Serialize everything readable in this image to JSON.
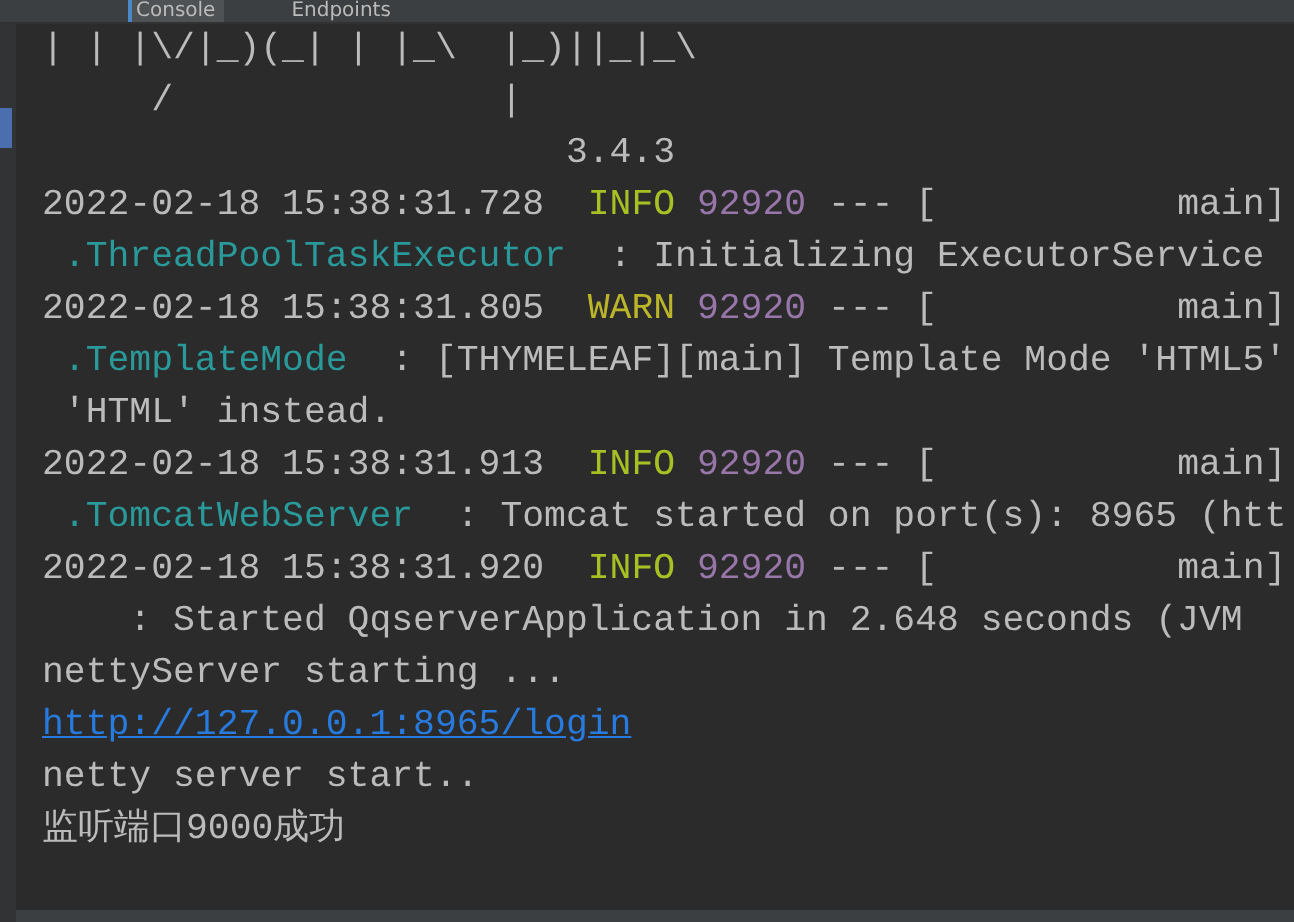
{
  "tabs": [
    {
      "label": "Console",
      "selected": true
    },
    {
      "label": "Endpoints",
      "selected": false
    }
  ],
  "lines": [
    {
      "segments": [
        {
          "kind": "plain",
          "text": "| | |\\/|_)(_| | |_\\  |_)||_|_\\"
        }
      ]
    },
    {
      "segments": [
        {
          "kind": "plain",
          "text": "     /               |"
        }
      ]
    },
    {
      "segments": [
        {
          "kind": "plain",
          "text": "                        3.4.3"
        }
      ]
    },
    {
      "segments": [
        {
          "kind": "plain",
          "text": "2022-02-18 15:38:31.728  "
        },
        {
          "kind": "info",
          "text": "INFO"
        },
        {
          "kind": "pid",
          "text": " 92920"
        },
        {
          "kind": "plain",
          "text": " --- [           main]"
        }
      ]
    },
    {
      "segments": [
        {
          "kind": "logger",
          "text": " .ThreadPoolTaskExecutor"
        },
        {
          "kind": "plain",
          "text": "  : Initializing ExecutorService"
        }
      ]
    },
    {
      "segments": [
        {
          "kind": "plain",
          "text": "2022-02-18 15:38:31.805  "
        },
        {
          "kind": "warn",
          "text": "WARN"
        },
        {
          "kind": "pid",
          "text": " 92920"
        },
        {
          "kind": "plain",
          "text": " --- [           main]"
        }
      ]
    },
    {
      "segments": [
        {
          "kind": "logger",
          "text": " .TemplateMode"
        },
        {
          "kind": "plain",
          "text": "  : [THYMELEAF][main] Template Mode 'HTML5'"
        }
      ]
    },
    {
      "segments": [
        {
          "kind": "plain",
          "text": " 'HTML' instead."
        }
      ]
    },
    {
      "segments": [
        {
          "kind": "plain",
          "text": "2022-02-18 15:38:31.913  "
        },
        {
          "kind": "info",
          "text": "INFO"
        },
        {
          "kind": "pid",
          "text": " 92920"
        },
        {
          "kind": "plain",
          "text": " --- [           main]"
        }
      ]
    },
    {
      "segments": [
        {
          "kind": "logger",
          "text": " .TomcatWebServer"
        },
        {
          "kind": "plain",
          "text": "  : Tomcat started on port(s): 8965 (htt"
        }
      ]
    },
    {
      "segments": [
        {
          "kind": "plain",
          "text": "2022-02-18 15:38:31.920  "
        },
        {
          "kind": "info",
          "text": "INFO"
        },
        {
          "kind": "pid",
          "text": " 92920"
        },
        {
          "kind": "plain",
          "text": " --- [           main]"
        }
      ]
    },
    {
      "segments": [
        {
          "kind": "plain",
          "text": "    : Started QqserverApplication in 2.648 seconds (JVM"
        }
      ]
    },
    {
      "segments": [
        {
          "kind": "plain",
          "text": "nettyServer starting ..."
        }
      ]
    },
    {
      "segments": [
        {
          "kind": "link",
          "text": "http://127.0.0.1:8965/login"
        }
      ]
    },
    {
      "segments": [
        {
          "kind": "plain",
          "text": "netty server start.."
        }
      ]
    },
    {
      "segments": [
        {
          "kind": "plain",
          "text": "监听端口9000成功"
        }
      ]
    }
  ]
}
